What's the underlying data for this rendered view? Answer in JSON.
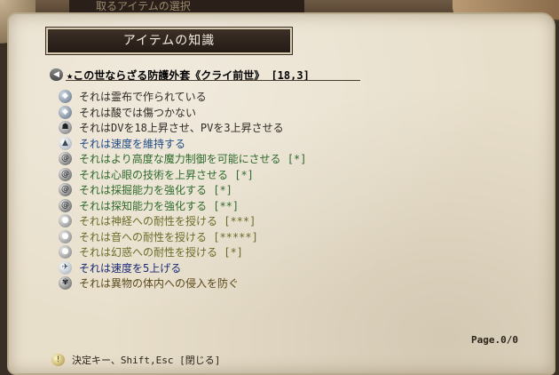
{
  "background_window": {
    "title": "取るアイテムの選択"
  },
  "window": {
    "header": "アイテムの知識",
    "item_title": "★この世ならざる防護外套《クライ前世》 [18,3]",
    "properties": [
      {
        "icon": "blue-diamond-icon",
        "text": "それは霊布で作られている",
        "color": "#2e2a25"
      },
      {
        "icon": "blue-diamond-icon",
        "text": "それは酸では傷つかない",
        "color": "#2e2a25"
      },
      {
        "icon": "helmet-icon",
        "text": "それはDVを18上昇させ、PVを3上昇させる",
        "color": "#2e2a25"
      },
      {
        "icon": "boots-icon",
        "text": "それは速度を維持する",
        "color": "#1f4a86"
      },
      {
        "icon": "swirl-icon",
        "text": "それはより高度な魔力制御を可能にさせる [*]",
        "color": "#2f6a2c"
      },
      {
        "icon": "swirl-icon",
        "text": "それは心眼の技術を上昇させる [*]",
        "color": "#2f6a2c"
      },
      {
        "icon": "swirl-icon",
        "text": "それは採掘能力を強化する [*]",
        "color": "#2f6a2c"
      },
      {
        "icon": "swirl-icon",
        "text": "それは探知能力を強化する [**]",
        "color": "#2f6a2c"
      },
      {
        "icon": "shield-orb-icon",
        "text": "それは神経への耐性を授ける [***]",
        "color": "#6b6b28"
      },
      {
        "icon": "shield-orb-icon",
        "text": "それは音への耐性を授ける [*****]",
        "color": "#6b6b28"
      },
      {
        "icon": "shield-orb-icon",
        "text": "それは幻惑への耐性を授ける [*]",
        "color": "#6b6b28"
      },
      {
        "icon": "wing-icon",
        "text": "それは速度を5上げる",
        "color": "#1a2a78"
      },
      {
        "icon": "creature-icon",
        "text": "それは異物の体内への侵入を防ぐ",
        "color": "#5a4a1a"
      }
    ],
    "page_indicator": "Page.0/0",
    "footer_hint": "決定キー、Shift,Esc [閉じる]"
  }
}
